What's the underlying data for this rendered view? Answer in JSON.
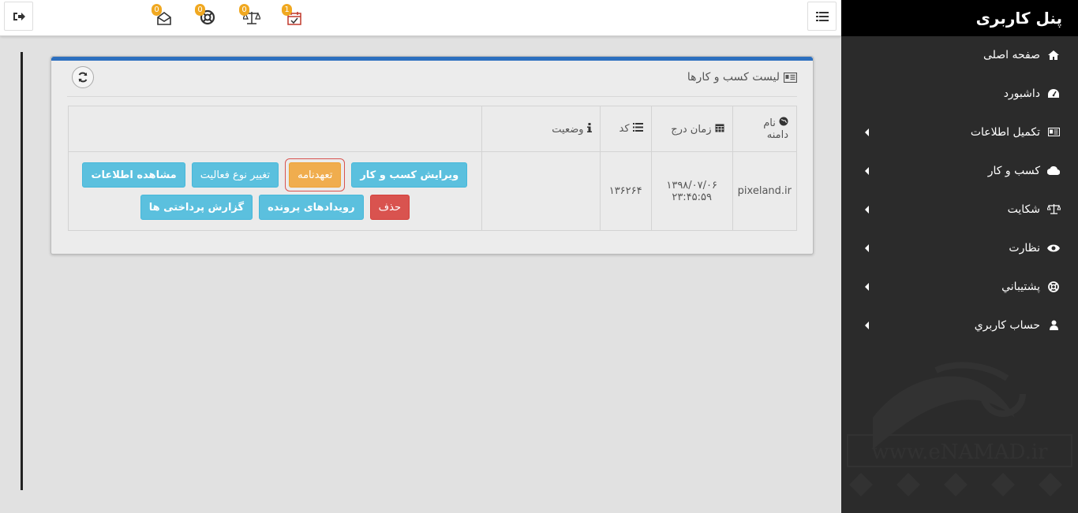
{
  "sidebar": {
    "title": "پنل کاربری",
    "items": [
      {
        "label": "صفحه اصلی",
        "icon": "home-icon",
        "arrow": false
      },
      {
        "label": "داشبورد",
        "icon": "dashboard-icon",
        "arrow": false
      },
      {
        "label": "تکمیل اطلاعات",
        "icon": "id-card-icon",
        "arrow": true
      },
      {
        "label": "کسب و کار",
        "icon": "cloud-icon",
        "arrow": true
      },
      {
        "label": "شکایت",
        "icon": "balance-scale-icon",
        "arrow": true
      },
      {
        "label": "نظارت",
        "icon": "eye-icon",
        "arrow": true
      },
      {
        "label": "پشتيباني",
        "icon": "life-ring-icon",
        "arrow": true
      },
      {
        "label": "حساب کاربري",
        "icon": "user-icon",
        "arrow": true
      }
    ]
  },
  "topbar": {
    "notifications": [
      {
        "name": "calendar-check-icon",
        "count": "1"
      },
      {
        "name": "balance-scale-icon",
        "count": "0"
      },
      {
        "name": "life-ring-icon",
        "count": "0"
      },
      {
        "name": "envelope-open-icon",
        "count": "0"
      }
    ]
  },
  "panel": {
    "title": "لیست کسب و کارها",
    "columns": {
      "domain": "نام دامنه",
      "date": "زمان درج",
      "code": "کد",
      "status": "وضعیت"
    },
    "row": {
      "domain": "pixeland.ir",
      "date": "۱۳۹۸/۰۷/۰۶",
      "time": "۲۳:۴۵:۵۹",
      "code": "۱۳۶۲۶۴",
      "status": ""
    },
    "actions": {
      "view": "مشاهده اطلاعات",
      "change_activity": "تغییر نوع فعالیت",
      "commitment": "تعهدنامه",
      "edit": "ویرایش کسب و کار",
      "payments": "گزارش پرداختی ها",
      "events": "رویدادهای پرونده",
      "delete": "حذف"
    }
  },
  "watermark": "www.eNAMAD.ir",
  "colors": {
    "accent": "#2c6fbf",
    "info": "#5bc0de",
    "warning": "#f0ad4e",
    "danger": "#d9534f",
    "sidebar_bg": "#2b2b2b"
  }
}
